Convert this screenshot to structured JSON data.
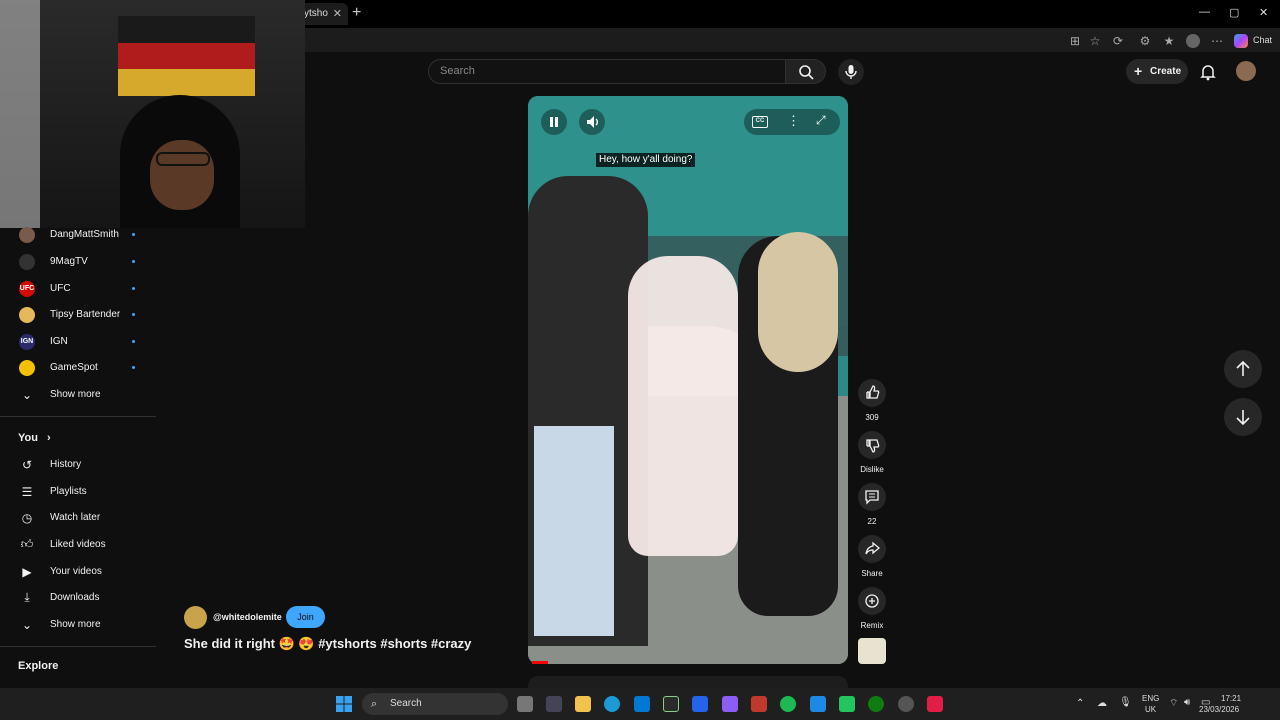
{
  "browser": {
    "tab_title": "ytsho",
    "tab_close": "✕",
    "new_tab": "+",
    "window_controls": [
      "—",
      "▢",
      "✕"
    ],
    "copilot_label": "Chat"
  },
  "header": {
    "search_placeholder": "Search",
    "create_label": "Create"
  },
  "sidebar": {
    "subscriptions": [
      {
        "name": "DangMattSmith",
        "avatar_text": "",
        "avatar_color": "#7a5a4a"
      },
      {
        "name": "9MagTV",
        "avatar_text": "",
        "avatar_color": "#333333"
      },
      {
        "name": "UFC",
        "avatar_text": "UFC",
        "avatar_color": "#d20a0a"
      },
      {
        "name": "Tipsy Bartender",
        "avatar_text": "",
        "avatar_color": "#e6b85c"
      },
      {
        "name": "IGN",
        "avatar_text": "IGN",
        "avatar_color": "#2b2b6b"
      },
      {
        "name": "GameSpot",
        "avatar_text": "",
        "avatar_color": "#f2c300"
      }
    ],
    "show_more_1": "Show more",
    "you_heading": "You",
    "you_items": [
      {
        "label": "History",
        "icon": "history-icon"
      },
      {
        "label": "Playlists",
        "icon": "playlists-icon"
      },
      {
        "label": "Watch later",
        "icon": "watch-later-icon"
      },
      {
        "label": "Liked videos",
        "icon": "liked-videos-icon"
      },
      {
        "label": "Your videos",
        "icon": "your-videos-icon"
      },
      {
        "label": "Downloads",
        "icon": "downloads-icon"
      }
    ],
    "show_more_2": "Show more",
    "explore_heading": "Explore"
  },
  "player": {
    "caption": "Hey, how y'all doing?",
    "cc_label": "CC",
    "progress_fraction": 0.05
  },
  "actions": {
    "like_count": "309",
    "dislike_label": "Dislike",
    "comments_count": "22",
    "share_label": "Share",
    "remix_label": "Remix"
  },
  "channel": {
    "handle": "@whitedolemite",
    "join_label": "Join"
  },
  "video": {
    "title": "She did it right 🤩 😍 #ytshorts #shorts #crazy"
  },
  "taskbar": {
    "search_label": "Search",
    "lang_top": "ENG",
    "lang_bottom": "UK",
    "time": "17:21",
    "date": "23/03/2026"
  }
}
